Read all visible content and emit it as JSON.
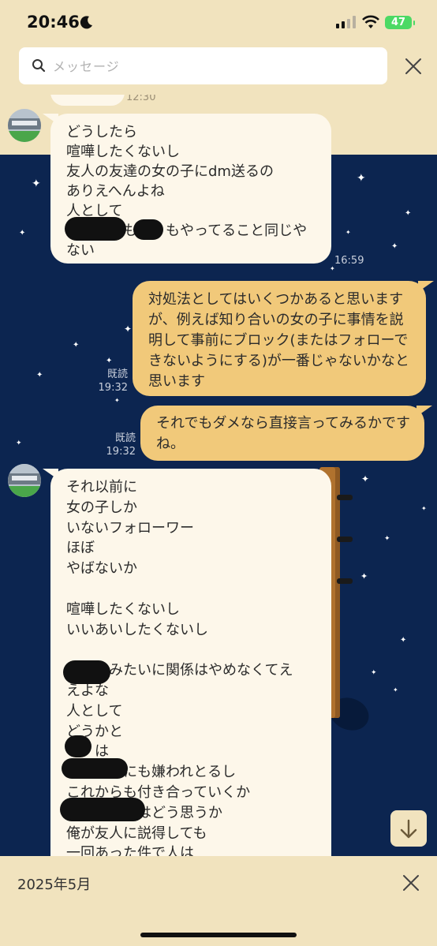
{
  "status": {
    "time": "20:46",
    "battery": "47"
  },
  "search": {
    "placeholder": "メッセージ"
  },
  "messages": [
    {
      "id": 0,
      "side": "left",
      "text": "",
      "time": "12:30"
    },
    {
      "id": 1,
      "side": "left",
      "text": "どうしたら\n喧嘩したくないし\n友人の友達の女の子にdm送るの\nありえへんよね\n人として\n　　　　も　　もやってること同じや\nない",
      "time": "16:59"
    },
    {
      "id": 2,
      "side": "right",
      "text": "対処法としてはいくつかあると思いますが、例えば知り合いの女の子に事情を説明して事前にブロック(またはフォローできないようにする)が一番じゃないかなと思います",
      "read": "既読",
      "time": "19:32"
    },
    {
      "id": 3,
      "side": "right",
      "text": "それでもダメなら直接言ってみるかですね。",
      "read": "既読",
      "time": "19:32"
    },
    {
      "id": 4,
      "side": "left",
      "text": "それ以前に\n女の子しか\nいないフォローワー\nほぼ\nやばないか\n\n喧嘩したくないし\nいいあいしたくないし\n\n　　　みたいに関係はやめなくてえ\nえよな\n人として\nどうかと\n　　は\n　　　　にも嫌われとるし\nこれからも付き合っていくか\n　　　　　はどう思うか\n俺が友人に説得しても\n一回あった件で人は"
    }
  ],
  "footer": {
    "date": "2025年5月"
  },
  "colors": {
    "accent": "#f1e3be",
    "night": "#0c2550",
    "right_bubble": "#f1c97a",
    "left_bubble": "#fdf7ea"
  },
  "icons": {
    "search": "search-icon",
    "close": "close-icon",
    "down": "arrow-down-icon",
    "moon": "moon-icon"
  }
}
